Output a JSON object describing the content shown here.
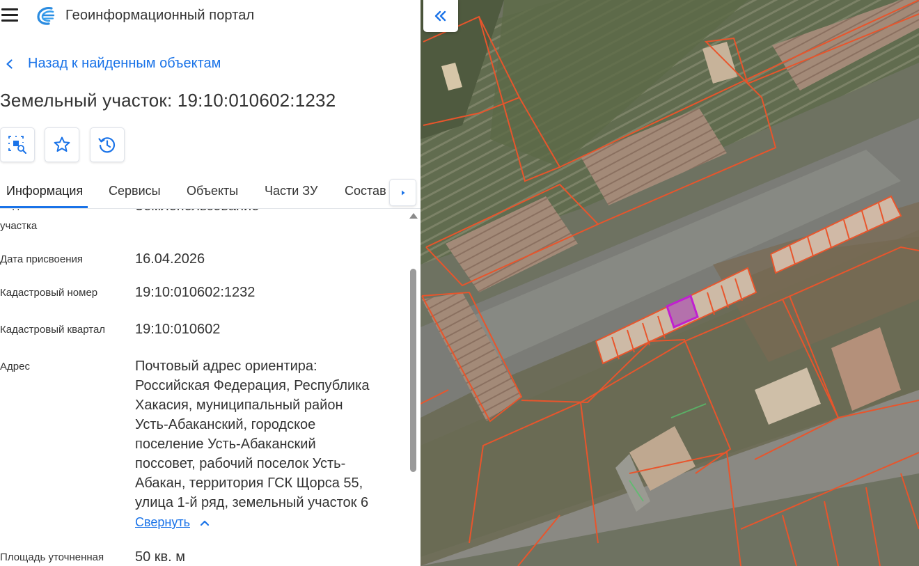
{
  "app": {
    "title": "Геоинформационный портал"
  },
  "nav": {
    "back_label": "Назад к найденным объектам"
  },
  "object": {
    "title": "Земельный участок: 19:10:010602:1232"
  },
  "tabs": [
    {
      "label": "Информация",
      "active": true
    },
    {
      "label": "Сервисы",
      "active": false
    },
    {
      "label": "Объекты",
      "active": false
    },
    {
      "label": "Части ЗУ",
      "active": false
    },
    {
      "label": "Состав",
      "active": false
    }
  ],
  "info": {
    "partial_row": {
      "label_line1": "Вид земельного",
      "label_line2": "участка",
      "value": "Землепользование"
    },
    "rows": [
      {
        "label": "Дата присвоения",
        "value": "16.04.2026"
      },
      {
        "label": "Кадастровый номер",
        "value": "19:10:010602:1232"
      },
      {
        "label": "Кадастровый квартал",
        "value": "19:10:010602"
      },
      {
        "label": "Адрес",
        "value_lines": [
          "Почтовый адрес ориентира:",
          "Российская Федерация, Республика",
          "Хакасия, муниципальный район",
          "Усть-Абаканский, городское",
          "поселение Усть-Абаканский",
          "поссовет, рабочий поселок Усть-",
          "Абакан, территория ГСК Щорса 55,",
          "улица 1-й ряд, земельный участок 6"
        ]
      },
      {
        "label": "Площадь уточненная",
        "value": "50 кв. м"
      }
    ],
    "collapse_label": "Свернуть"
  },
  "icons": {
    "menu": "hamburger-icon",
    "logo": "portal-logo-icon",
    "back": "chevron-left-icon",
    "tool1": "map-search-icon",
    "tool2": "star-icon",
    "tool3": "history-icon",
    "tab_next": "caret-right-icon",
    "collapse": "chevron-up-icon",
    "panel_toggle": "double-chevron-left-icon"
  },
  "colors": {
    "accent": "#1a73e8",
    "parcel_outline": "#e8552c",
    "selected_parcel": "#b020c0"
  }
}
